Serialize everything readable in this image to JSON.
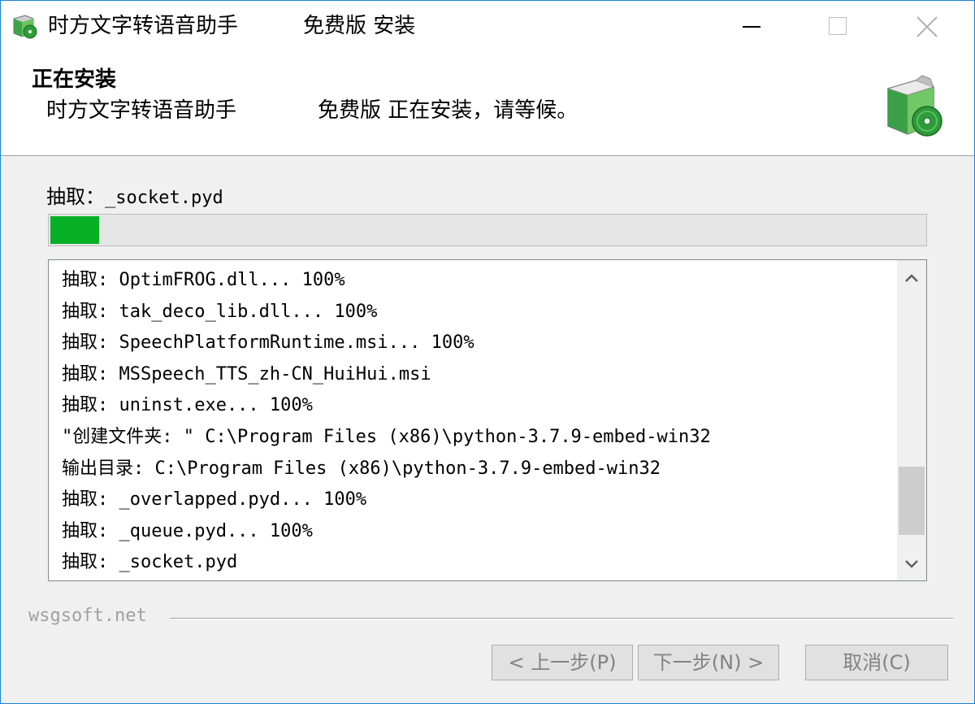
{
  "window": {
    "title_app": "时方文字转语音助手",
    "title_edition": "免费版 安装",
    "controls": {
      "minimize": "minimize-icon",
      "maximize": "maximize-icon",
      "close": "close-icon"
    }
  },
  "header": {
    "title": "正在安装",
    "subtitle_app": "时方文字转语音助手",
    "subtitle_status": "免费版 正在安装，请等候。",
    "icon": "installer-box-cd-icon"
  },
  "progress": {
    "label_prefix": "抽取：",
    "label_file": "_socket.pyd",
    "percent": 5.6,
    "bar_color": "#06b025"
  },
  "log": {
    "lines": [
      "抽取: OptimFROG.dll... 100%",
      "抽取: tak_deco_lib.dll... 100%",
      "抽取: SpeechPlatformRuntime.msi... 100%",
      "抽取: MSSpeech_TTS_zh-CN_HuiHui.msi",
      "抽取: uninst.exe... 100%",
      "\"创建文件夹: \" C:\\Program Files (x86)\\python-3.7.9-embed-win32",
      "输出目录: C:\\Program Files (x86)\\python-3.7.9-embed-win32",
      "抽取: _overlapped.pyd... 100%",
      "抽取: _queue.pyd... 100%",
      "抽取: _socket.pyd"
    ],
    "scroll": {
      "thumb_start_fraction": 0.68,
      "thumb_size_fraction": 0.27
    }
  },
  "footer": {
    "brand": "wsgsoft.net",
    "buttons": {
      "back": "< 上一步(P)",
      "next": "下一步(N) >",
      "cancel": "取消(C)"
    }
  }
}
